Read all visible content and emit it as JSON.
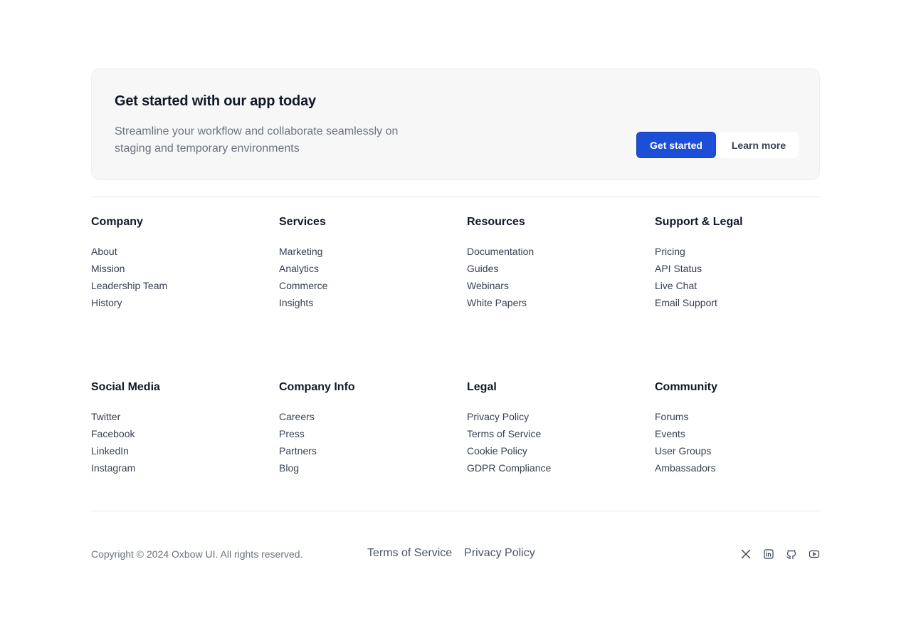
{
  "cta": {
    "title": "Get started with our app today",
    "description": "Streamline your workflow and collaborate seamlessly on staging and temporary environments",
    "primary_label": "Get started",
    "secondary_label": "Learn more"
  },
  "columns": [
    {
      "title": "Company",
      "links": [
        "About",
        "Mission",
        "Leadership Team",
        "History"
      ]
    },
    {
      "title": "Services",
      "links": [
        "Marketing",
        "Analytics",
        "Commerce",
        "Insights"
      ]
    },
    {
      "title": "Resources",
      "links": [
        "Documentation",
        "Guides",
        "Webinars",
        "White Papers"
      ]
    },
    {
      "title": "Support & Legal",
      "links": [
        "Pricing",
        "API Status",
        "Live Chat",
        "Email Support"
      ]
    },
    {
      "title": "Social Media",
      "links": [
        "Twitter",
        "Facebook",
        "LinkedIn",
        "Instagram"
      ]
    },
    {
      "title": "Company Info",
      "links": [
        "Careers",
        "Press",
        "Partners",
        "Blog"
      ]
    },
    {
      "title": "Legal",
      "links": [
        "Privacy Policy",
        "Terms of Service",
        "Cookie Policy",
        "GDPR Compliance"
      ]
    },
    {
      "title": "Community",
      "links": [
        "Forums",
        "Events",
        "User Groups",
        "Ambassadors"
      ]
    }
  ],
  "bottom": {
    "copyright": "Copyright © 2024 Oxbow UI. All rights reserved.",
    "links": [
      "Terms of Service",
      "Privacy Policy"
    ]
  },
  "socials": [
    "x-icon",
    "linkedin-icon",
    "github-icon",
    "youtube-icon"
  ],
  "colors": {
    "primary": "#1d4ed8",
    "cta_background": "#f7f7f7",
    "text": "#111827",
    "muted": "#6b7280"
  }
}
